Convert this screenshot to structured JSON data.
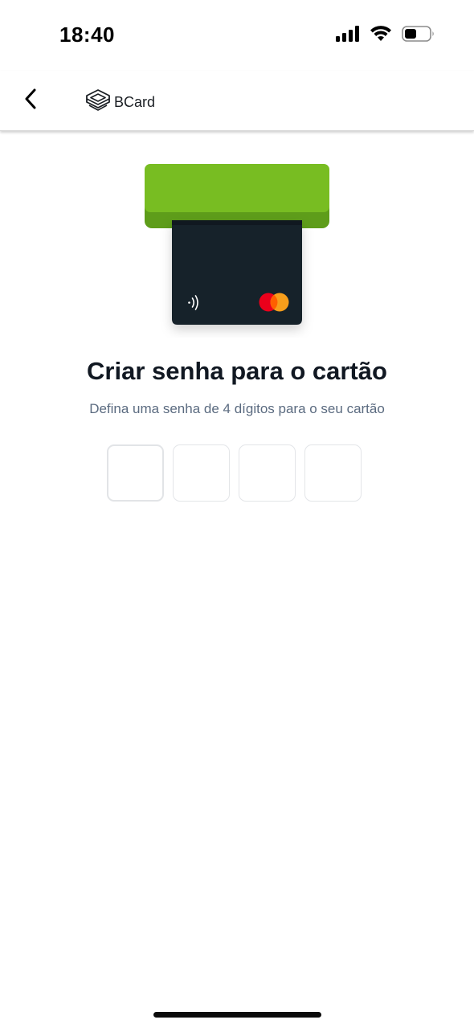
{
  "status_bar": {
    "time": "18:40",
    "icons": [
      "cellular-signal-icon",
      "wifi-icon",
      "battery-icon"
    ]
  },
  "header": {
    "back_icon": "chevron-left-icon",
    "brand_logo_icon": "bcard-logo-icon",
    "brand_name": "BCard"
  },
  "illustration": {
    "description_icon": "card-insert-illustration",
    "colors": {
      "slot_top": "#78bd22",
      "slot_bottom": "#5e9d1a",
      "card": "#17202b",
      "mastercard_red": "#eb001b",
      "mastercard_orange": "#f79e1b"
    }
  },
  "main": {
    "title": "Criar senha para o cartão",
    "subtitle": "Defina uma senha de 4 dígitos para o seu cartão",
    "pin_length": 4,
    "pin_values": [
      "",
      "",
      "",
      ""
    ]
  }
}
